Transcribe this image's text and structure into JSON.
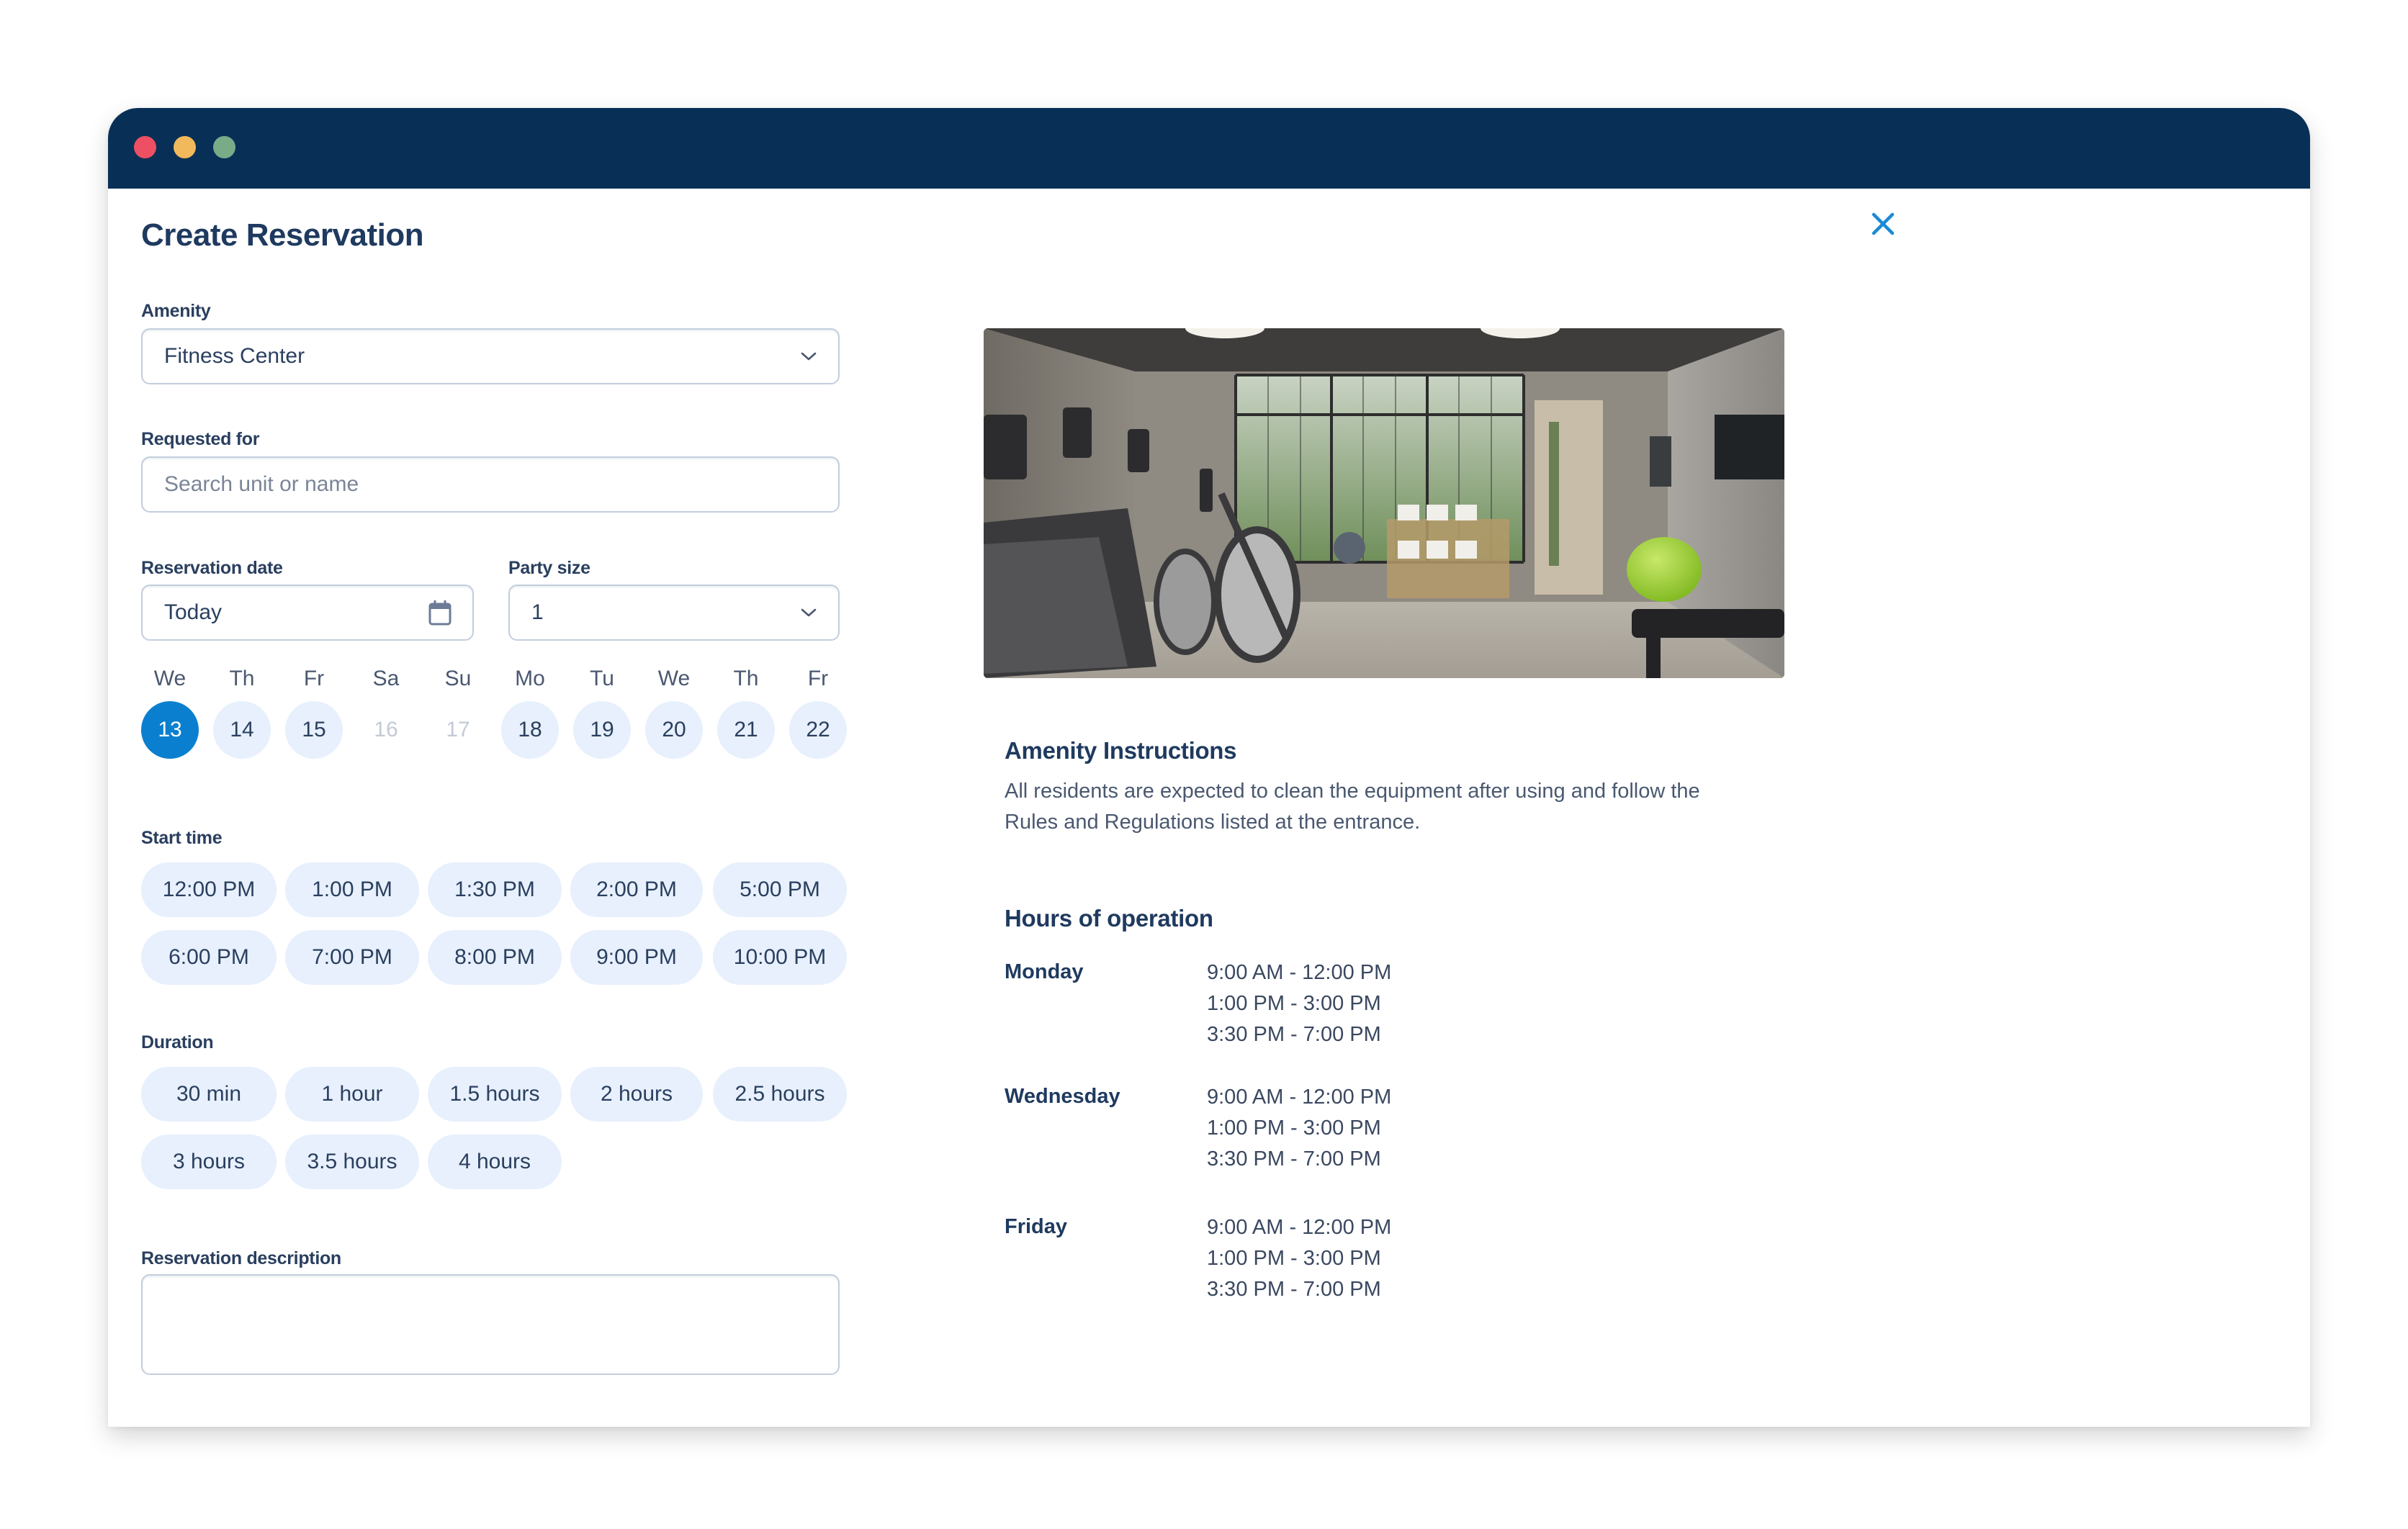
{
  "window": {
    "titlebar_color": "#083057",
    "controls": [
      "close",
      "minimize",
      "maximize"
    ]
  },
  "page": {
    "title": "Create Reservation",
    "close_icon": "close-icon"
  },
  "form": {
    "amenity": {
      "label": "Amenity",
      "value": "Fitness Center"
    },
    "requested_for": {
      "label": "Requested for",
      "placeholder": "Search unit or name",
      "value": ""
    },
    "reservation_date": {
      "label": "Reservation date",
      "value": "Today",
      "icon": "calendar-icon"
    },
    "party_size": {
      "label": "Party size",
      "value": "1"
    },
    "calendar": {
      "days": [
        {
          "weekday": "We",
          "date": "13",
          "state": "selected"
        },
        {
          "weekday": "Th",
          "date": "14",
          "state": "available"
        },
        {
          "weekday": "Fr",
          "date": "15",
          "state": "available"
        },
        {
          "weekday": "Sa",
          "date": "16",
          "state": "disabled"
        },
        {
          "weekday": "Su",
          "date": "17",
          "state": "disabled"
        },
        {
          "weekday": "Mo",
          "date": "18",
          "state": "available"
        },
        {
          "weekday": "Tu",
          "date": "19",
          "state": "available"
        },
        {
          "weekday": "We",
          "date": "20",
          "state": "available"
        },
        {
          "weekday": "Th",
          "date": "21",
          "state": "available"
        },
        {
          "weekday": "Fr",
          "date": "22",
          "state": "available"
        }
      ]
    },
    "start_time": {
      "label": "Start time",
      "options": [
        "12:00 PM",
        "1:00 PM",
        "1:30 PM",
        "2:00 PM",
        "5:00 PM",
        "6:00 PM",
        "7:00 PM",
        "8:00 PM",
        "9:00 PM",
        "10:00 PM"
      ]
    },
    "duration": {
      "label": "Duration",
      "options": [
        "30 min",
        "1 hour",
        "1.5 hours",
        "2 hours",
        "2.5 hours",
        "3 hours",
        "3.5 hours",
        "4 hours"
      ]
    },
    "description": {
      "label": "Reservation description",
      "value": ""
    }
  },
  "details": {
    "image_alt": "Fitness center interior with treadmills, ellipticals and exercise ball",
    "instructions": {
      "heading": "Amenity Instructions",
      "line1": "All residents are expected to clean the equipment after using and follow the",
      "line2": "Rules and Regulations listed at the entrance."
    },
    "hours": {
      "heading": "Hours of operation",
      "days": [
        {
          "day": "Monday",
          "ranges": [
            "9:00 AM - 12:00 PM",
            "1:00 PM - 3:00 PM",
            "3:30 PM - 7:00 PM"
          ]
        },
        {
          "day": "Wednesday",
          "ranges": [
            "9:00 AM - 12:00 PM",
            "1:00 PM - 3:00 PM",
            "3:30 PM - 7:00 PM"
          ]
        },
        {
          "day": "Friday",
          "ranges": [
            "9:00 AM - 12:00 PM",
            "1:00 PM - 3:00 PM",
            "3:30 PM - 7:00 PM"
          ]
        }
      ]
    }
  },
  "colors": {
    "accent": "#0b7fcf",
    "pill_bg": "#e7f0fc",
    "heading": "#1f3a5f",
    "close_icon": "#1a8ad6"
  }
}
